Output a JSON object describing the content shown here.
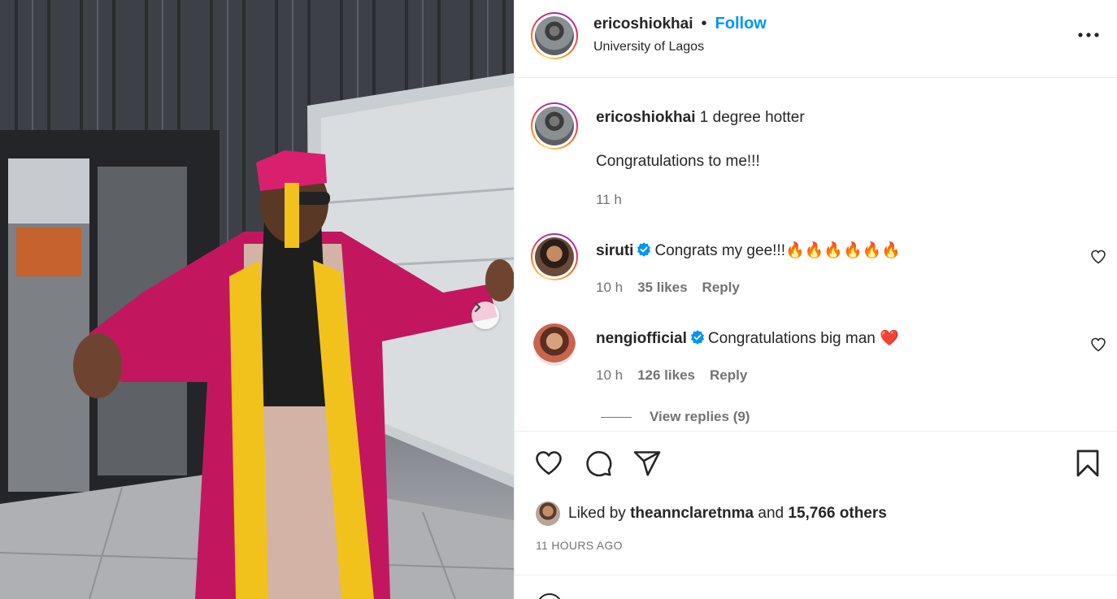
{
  "post": {
    "author": "ericoshiokhai",
    "separator": "•",
    "follow_label": "Follow",
    "location": "University of Lagos"
  },
  "caption": {
    "username": "ericoshiokhai",
    "line1": "1 degree hotter",
    "line2": "Congratulations to me!!!",
    "time": "11 h"
  },
  "comments": [
    {
      "username": "siruti",
      "verified": true,
      "text": "Congrats my gee!!!🔥🔥🔥🔥🔥🔥",
      "time": "10 h",
      "likes": "35 likes",
      "reply_label": "Reply"
    },
    {
      "username": "nengiofficial",
      "verified": true,
      "text": "Congratulations big man ❤️",
      "time": "10 h",
      "likes": "126 likes",
      "reply_label": "Reply"
    }
  ],
  "view_replies_label": "View replies (9)",
  "likes_summary": {
    "prefix": "Liked by",
    "user": "theannclaretnma",
    "joiner": "and",
    "others": "15,766 others"
  },
  "timestamp": "11 HOURS AGO",
  "icons": {
    "more": "more-horizontal-icon",
    "like": "heart-icon",
    "comment": "comment-icon",
    "share": "share-icon",
    "save": "bookmark-icon",
    "carousel_next": "chevron-right-icon",
    "verified": "verified-badge-icon"
  },
  "colors": {
    "follow": "#0095f6",
    "verified": "#0095f6",
    "muted": "#737373",
    "text": "#262626"
  }
}
